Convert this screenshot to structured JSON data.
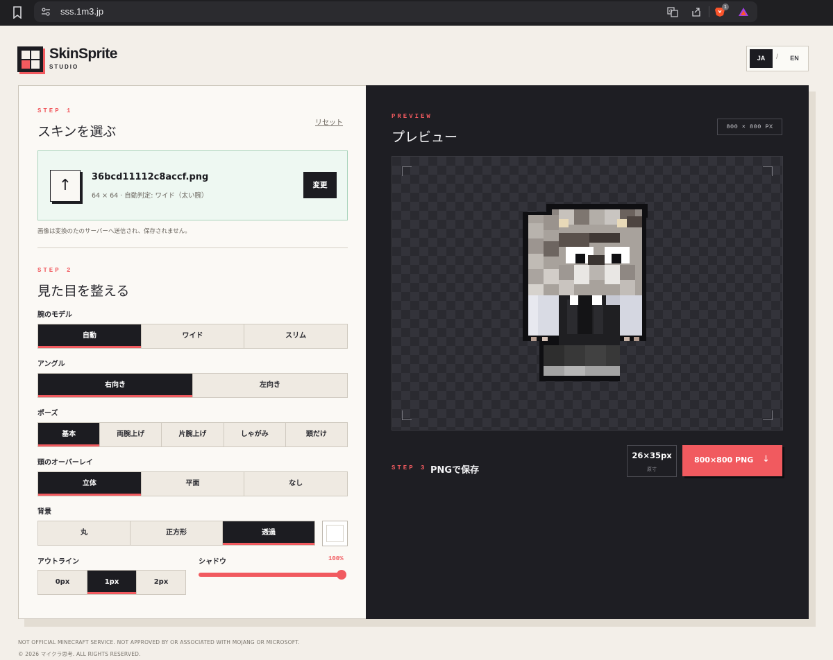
{
  "browser": {
    "url": "sss.1m3.jp",
    "icons": [
      "bookmark-icon",
      "site-settings-icon",
      "translate-icon",
      "share-icon",
      "brave-shield-icon",
      "brave-rewards-icon"
    ],
    "shield_badge": "1"
  },
  "header": {
    "brand": "SkinSprite",
    "brand_sub": "STUDIO",
    "lang_ja": "JA",
    "lang_sep": "/",
    "lang_en": "EN"
  },
  "step1": {
    "step_label": "STEP 1",
    "title": "スキンを選ぶ",
    "reset": "リセット",
    "upload_icon": "↑",
    "file_name": "36bcd11112c8accf.png",
    "file_meta": "64 × 64 · 自動判定: ワイド（太い腕）",
    "change_button": "変更",
    "note": "画像は変換のたのサーバーへ送信され、保存されません。"
  },
  "step2": {
    "step_label": "STEP 2",
    "title": "見た目を整える",
    "arm_model": {
      "label": "腕のモデル",
      "options": [
        "自動",
        "ワイド",
        "スリム"
      ],
      "selected": "自動"
    },
    "angle": {
      "label": "アングル",
      "options": [
        "右向き",
        "左向き"
      ],
      "selected": "右向き"
    },
    "pose": {
      "label": "ポーズ",
      "options": [
        "基本",
        "両腕上げ",
        "片腕上げ",
        "しゃがみ",
        "頭だけ"
      ],
      "selected": "基本"
    },
    "head_overlay": {
      "label": "頭のオーバーレイ",
      "options": [
        "立体",
        "平面",
        "なし"
      ],
      "selected": "立体"
    },
    "background": {
      "label": "背景",
      "options": [
        "丸",
        "正方形",
        "透過"
      ],
      "selected": "透過",
      "swatch_color": "#ffffff"
    },
    "outline": {
      "label": "アウトライン",
      "options": [
        "0px",
        "1px",
        "2px"
      ],
      "selected": "1px"
    },
    "shadow": {
      "label": "シャドウ",
      "value_text": "100%",
      "value": 1.0
    }
  },
  "preview": {
    "step_label": "PREVIEW",
    "title": "プレビュー",
    "dimensions": "800 × 800 PX"
  },
  "step3": {
    "step_label": "STEP 3",
    "title": "PNGで保存",
    "size_value": "26×35px",
    "size_sub": "原寸",
    "save_button": "800×800 PNG",
    "save_icon": "↓"
  },
  "footer": {
    "disclaimer": "NOT OFFICIAL MINECRAFT SERVICE. NOT APPROVED BY OR ASSOCIATED WITH MOJANG OR MICROSOFT.",
    "copyright": "© 2026 マイクラ思考. ALL RIGHTS RESERVED."
  },
  "colors": {
    "accent": "#f15a5f",
    "dark": "#1c1c21",
    "panel": "#1e1e23",
    "page_bg": "#f3efe9"
  }
}
